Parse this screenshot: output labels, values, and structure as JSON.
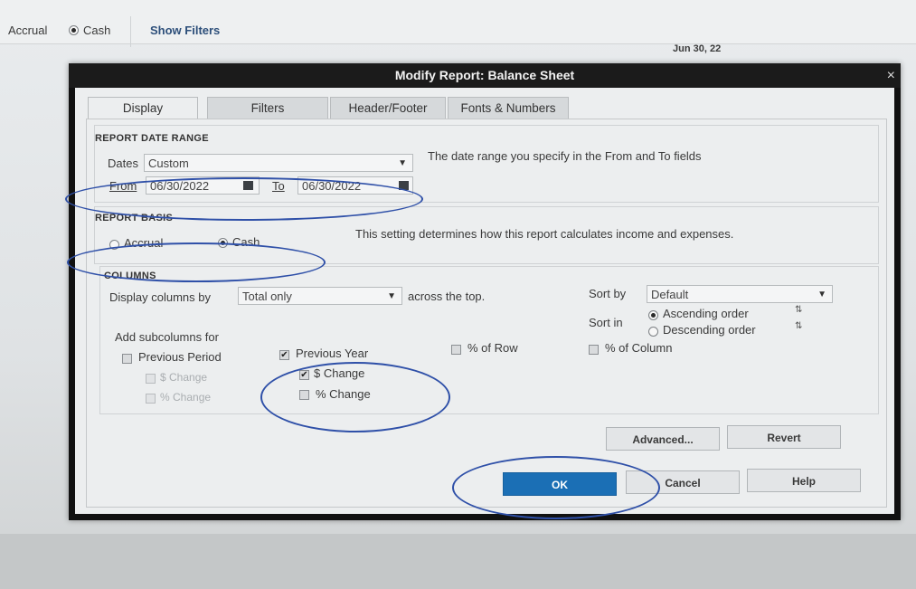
{
  "background": {
    "basis_accrual_label": "Accrual",
    "basis_cash_label": "Cash",
    "show_filters_label": "Show Filters",
    "column_header": "Jun 30, 22"
  },
  "dialog": {
    "title": "Modify Report: Balance Sheet",
    "close_glyph": "×",
    "tabs": [
      "Display",
      "Filters",
      "Header/Footer",
      "Fonts & Numbers"
    ],
    "report_date_range": {
      "heading": "REPORT DATE RANGE",
      "dates_label": "Dates",
      "dates_value": "Custom",
      "hint": "The date range you specify in the From and To fields",
      "from_label": "From",
      "from_value": "06/30/2022",
      "to_label": "To",
      "to_value": "06/30/2022"
    },
    "report_basis": {
      "heading": "REPORT BASIS",
      "accrual_label": "Accrual",
      "cash_label": "Cash",
      "selected": "Cash",
      "hint": "This setting determines how this report calculates income and expenses."
    },
    "columns": {
      "heading": "COLUMNS",
      "display_columns_label": "Display columns by",
      "display_columns_value": "Total only",
      "across_label": "across the top.",
      "sort_by_label": "Sort by",
      "sort_by_value": "Default",
      "sort_in_label": "Sort in",
      "ascending_label": "Ascending order",
      "descending_label": "Descending order",
      "sort_selected": "Ascending order",
      "add_subcolumns_label": "Add subcolumns for",
      "previous_period_label": "Previous Period",
      "pp_dollar_change_label": "$ Change",
      "pp_pct_change_label": "% Change",
      "previous_year_label": "Previous Year",
      "previous_year_checked": true,
      "py_dollar_change_label": "$ Change",
      "py_dollar_change_checked": true,
      "py_pct_change_label": "% Change",
      "pct_of_row_label": "% of Row",
      "pct_of_column_label": "% of Column"
    },
    "buttons": {
      "advanced": "Advanced...",
      "revert": "Revert",
      "ok": "OK",
      "cancel": "Cancel",
      "help": "Help"
    }
  },
  "colors": {
    "highlight_ring": "#2f50a8",
    "ok_button": "#1b6fb5",
    "dialog_frame": "#111111"
  }
}
